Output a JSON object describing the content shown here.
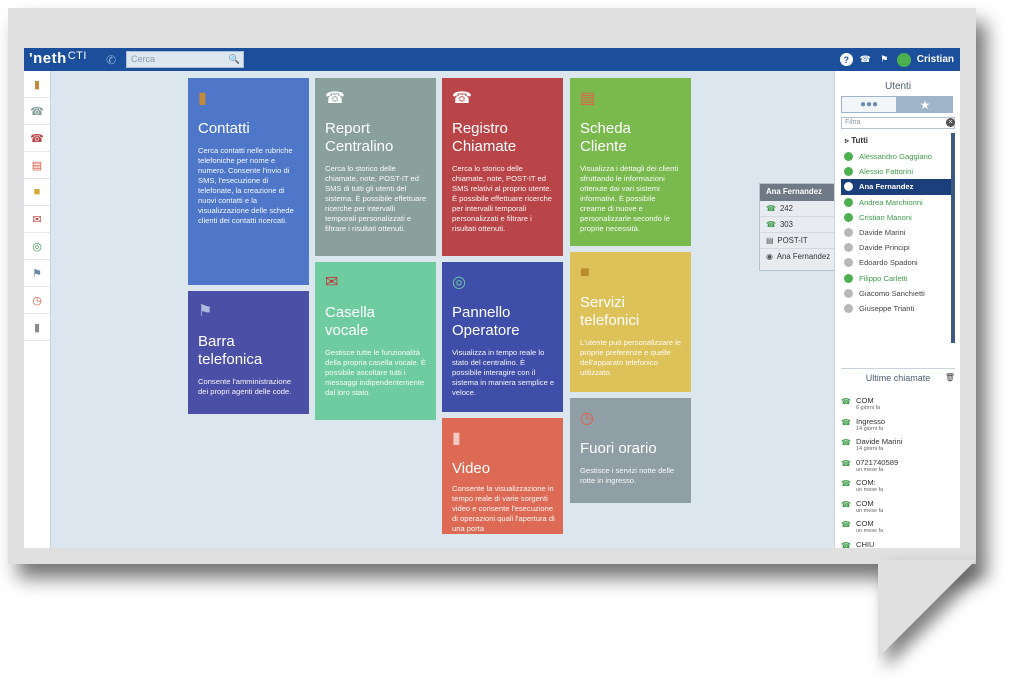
{
  "header": {
    "logo": "'neth",
    "logo_suffix": "CTI",
    "search_placeholder": "Cerca",
    "user_name": "Cristian"
  },
  "sidebar_icons": [
    "contacts-book-icon",
    "report-phone-icon",
    "call-history-icon",
    "customer-card-icon",
    "phone-services-icon",
    "voicemail-icon",
    "operator-panel-icon",
    "phone-bar-icon",
    "clock-icon",
    "video-camera-icon"
  ],
  "tiles": {
    "contatti": {
      "title": "Contatti",
      "desc": "Cerca contatti nelle rubriche telefoniche per nome e numero. Consente l'invio di SMS, l'esecuzione di telefonate, la creazione di nuovi contatti e la visualizzazione delle schede clienti dei contatti ricercati.",
      "color": "#4e77c9"
    },
    "report": {
      "title1": "Report",
      "title2": "Centralino",
      "desc": "Cerca lo storico delle chiamate, note, POST-IT ed SMS di tutti gli utenti del sistema. È possibile effettuare ricerche per intervalli temporali personalizzati e filtrare i risultati ottenuti.",
      "color": "#8aa09a"
    },
    "registro": {
      "title1": "Registro",
      "title2": "Chiamate",
      "desc": "Cerca lo storico delle chiamate, note, POST-IT ed SMS relativi al proprio utente. È possibile effettuare ricerche per intervalli temporali personalizzati e filtrare i risultati ottenuti.",
      "color": "#b94548"
    },
    "scheda": {
      "title1": "Scheda",
      "title2": "Cliente",
      "desc": "Visualizza i dettagli dei clienti sfruttando le informazioni ottenute dai vari sistemi informativi. È possibile crearne di nuove e personalizzarle secondo le proprie necessità.",
      "color": "#79b94e"
    },
    "barra": {
      "title1": "Barra",
      "title2": "telefonica",
      "desc": "Consente l'amministrazione dei propri agenti delle code.",
      "color": "#4b4fa6"
    },
    "casella": {
      "title1": "Casella",
      "title2": "vocale",
      "desc": "Gestisce tutte le funzionalità della propria casella vocale. È possibile ascoltare tutti i messaggi indipendentemente dal loro stato.",
      "color": "#6fcba0"
    },
    "pannello": {
      "title1": "Pannello",
      "title2": "Operatore",
      "desc": "Visualizza in tempo reale lo stato del centralino. È possibile interagire con il sistema in maniera semplice e veloce.",
      "color": "#3f4ea8"
    },
    "servizi": {
      "title1": "Servizi",
      "title2": "telefonici",
      "desc": "L'utente può personalizzare le proprie preferenze e quelle dell'apparato telefonico utilizzato.",
      "color": "#ddc25a"
    },
    "video": {
      "title": "Video",
      "desc": "Consente la visualizzazione in tempo reale di varie sorgenti video e consente l'esecuzione di operazioni quali l'apertura di una porta",
      "color": "#dd6a55"
    },
    "fuori": {
      "title": "Fuori orario",
      "desc": "Gestisce i servizi notte delle rotte in ingresso.",
      "color": "#909fa6"
    }
  },
  "users_panel": {
    "title": "Utenti",
    "filter_placeholder": "Filtra",
    "all_label": "Tutti",
    "users": [
      {
        "name": "Alessandro Gaggiano",
        "status": "online"
      },
      {
        "name": "Alessio Fattorini",
        "status": "online"
      },
      {
        "name": "Ana Fernandez",
        "status": "selected"
      },
      {
        "name": "Andrea Marchionni",
        "status": "online"
      },
      {
        "name": "Cristian Manoni",
        "status": "online"
      },
      {
        "name": "Davide Marini",
        "status": "offline"
      },
      {
        "name": "Davide Principi",
        "status": "offline"
      },
      {
        "name": "Edoardo Spadoni",
        "status": "offline"
      },
      {
        "name": "Filippo Carletti",
        "status": "online"
      },
      {
        "name": "Giacomo Sanchietti",
        "status": "offline"
      },
      {
        "name": "Giuseppe Trianti",
        "status": "offline"
      }
    ]
  },
  "user_card": {
    "name": "Ana Fernandez",
    "ext1": "242",
    "ext2": "303",
    "postit": "POST-IT",
    "chat": "Ana Fernandez"
  },
  "last_calls": {
    "title": "Ultime chiamate",
    "items": [
      {
        "name": "COM",
        "time": "6 giorni fa"
      },
      {
        "name": "Ingresso",
        "time": "14 giorni fa"
      },
      {
        "name": "Davide Marini",
        "time": "14 giorni fa"
      },
      {
        "name": "0721740589",
        "time": "un mese fa"
      },
      {
        "name": "COM:",
        "time": "un mese fa"
      },
      {
        "name": "COM",
        "time": "un mese fa"
      },
      {
        "name": "COM",
        "time": "un mese fa"
      },
      {
        "name": "CHIU",
        "time": ""
      }
    ]
  }
}
